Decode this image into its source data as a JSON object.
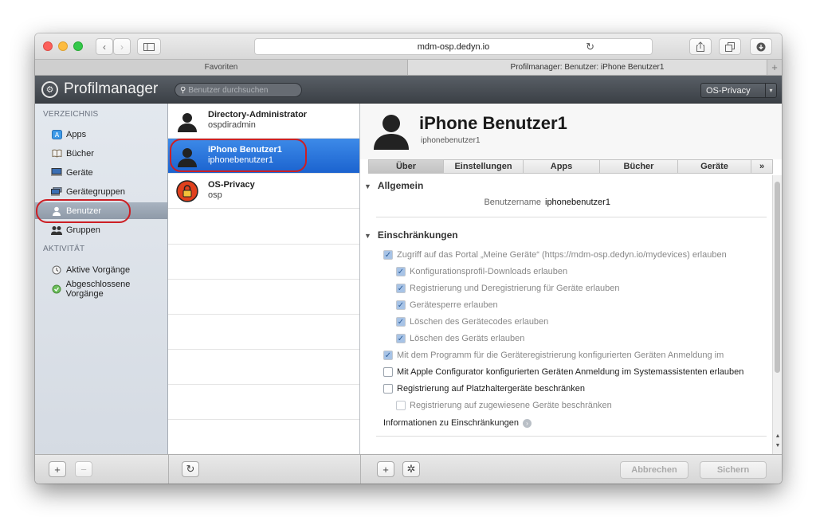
{
  "browser": {
    "url": "mdm-osp.dedyn.io",
    "tabs": {
      "favorites": "Favoriten",
      "active": "Profilmanager: Benutzer: iPhone Benutzer1",
      "plus": "+"
    }
  },
  "app": {
    "title": "Profilmanager",
    "search_placeholder": "Benutzer durchsuchen",
    "org_selector": "OS-Privacy"
  },
  "sidebar": {
    "section_directory": "VERZEICHNIS",
    "directory_items": [
      {
        "label": "Apps",
        "icon": "apps-icon"
      },
      {
        "label": "Bücher",
        "icon": "book-icon"
      },
      {
        "label": "Geräte",
        "icon": "device-icon"
      },
      {
        "label": "Gerätegruppen",
        "icon": "device-group-icon"
      },
      {
        "label": "Benutzer",
        "icon": "user-icon",
        "selected": true
      },
      {
        "label": "Gruppen",
        "icon": "group-icon"
      }
    ],
    "section_activity": "AKTIVITÄT",
    "activity_items": [
      {
        "label": "Aktive Vorgänge",
        "icon": "clock-icon"
      },
      {
        "label": "Abgeschlossene Vorgänge",
        "icon": "completed-icon"
      }
    ]
  },
  "list": {
    "items": [
      {
        "name": "Directory-Administrator",
        "sub": "ospdiradmin",
        "icon": "user-silhouette-icon"
      },
      {
        "name": "iPhone Benutzer1",
        "sub": "iphonebenutzer1",
        "icon": "user-silhouette-icon",
        "selected": true
      },
      {
        "name": "OS-Privacy",
        "sub": "osp",
        "icon": "lock-icon"
      }
    ]
  },
  "detail": {
    "name": "iPhone Benutzer1",
    "short_name": "iphonebenutzer1",
    "tabs": [
      "Über",
      "Einstellungen",
      "Apps",
      "Bücher",
      "Geräte",
      "»"
    ],
    "active_tab": "Über",
    "section_general": "Allgemein",
    "username_label": "Benutzername",
    "username_value": "iphonebenutzer1",
    "section_restrictions": "Einschränkungen",
    "restrictions": [
      {
        "label": "Zugriff auf das Portal „Meine Geräte“ (https://mdm-osp.dedyn.io/mydevices) erlauben",
        "checked": true,
        "indent": 0
      },
      {
        "label": "Konfigurationsprofil-Downloads erlauben",
        "checked": true,
        "indent": 1
      },
      {
        "label": "Registrierung und Deregistrierung für Geräte erlauben",
        "checked": true,
        "indent": 1
      },
      {
        "label": "Gerätesperre erlauben",
        "checked": true,
        "indent": 1
      },
      {
        "label": "Löschen des Gerätecodes erlauben",
        "checked": true,
        "indent": 1
      },
      {
        "label": "Löschen des Geräts erlauben",
        "checked": true,
        "indent": 1
      },
      {
        "label": "Mit dem Programm für die Geräteregistrierung konfigurierten Geräten Anmeldung im",
        "checked": true,
        "indent": 0
      },
      {
        "label": "Mit Apple Configurator konfigurierten Geräten Anmeldung im Systemassistenten erlauben",
        "checked": false,
        "indent": 0
      },
      {
        "label": "Registrierung auf Platzhaltergeräte beschränken",
        "checked": false,
        "indent": 0
      },
      {
        "label": "Registrierung auf zugewiesene Geräte beschränken",
        "checked": false,
        "indent": 1,
        "disabled": true
      }
    ],
    "info_link": "Informationen zu Einschränkungen"
  },
  "bottom": {
    "add": "+",
    "remove": "−",
    "refresh": "↻",
    "cancel": "Abbrechen",
    "save": "Sichern"
  },
  "colors": {
    "selection_blue": "#1b63cf",
    "annotation_red": "#cc1f24",
    "header_dark": "#3b4046"
  }
}
